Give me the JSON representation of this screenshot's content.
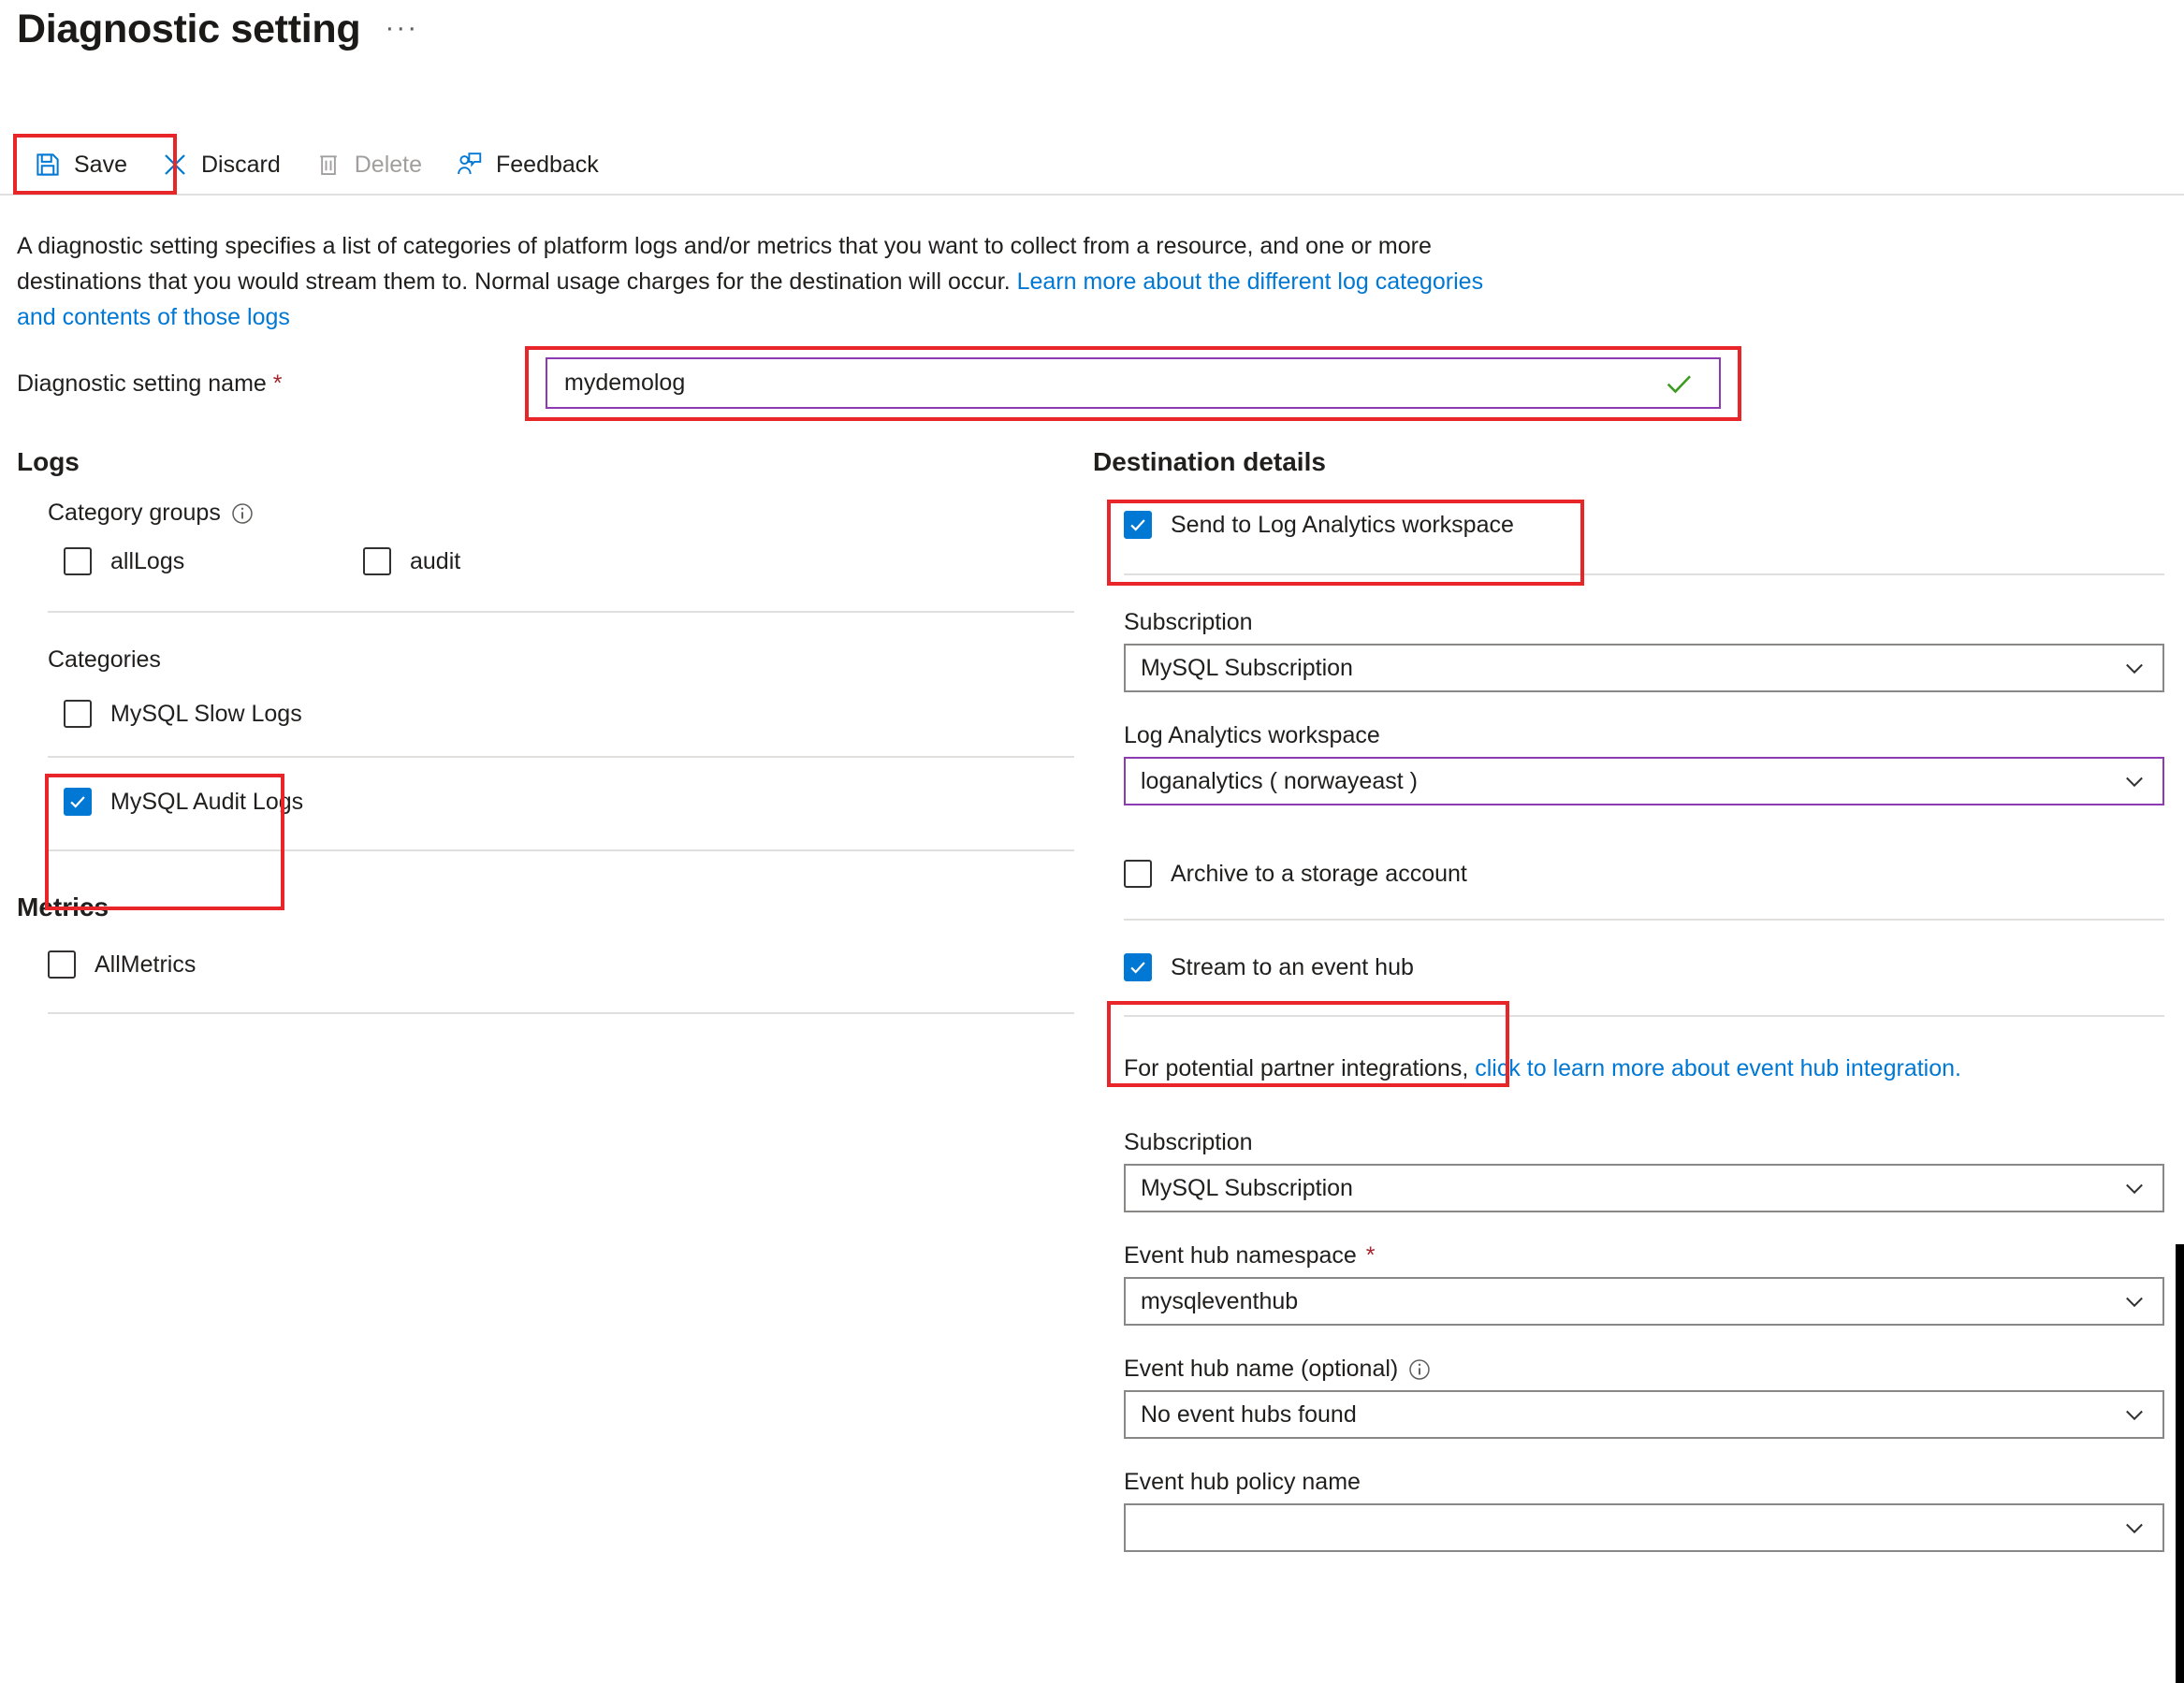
{
  "header": {
    "title": "Diagnostic setting",
    "more_label": "···"
  },
  "toolbar": {
    "save_label": "Save",
    "discard_label": "Discard",
    "delete_label": "Delete",
    "feedback_label": "Feedback"
  },
  "description": {
    "part1": "A diagnostic setting specifies a list of categories of platform logs and/or metrics that you want to collect from a resource, and one or more destinations that you would stream them to. Normal usage charges for the destination will occur. ",
    "link": "Learn more about the different log categories and contents of those logs"
  },
  "name_field": {
    "label": "Diagnostic setting name",
    "required_marker": "*",
    "value": "mydemolog",
    "placeholder": "",
    "valid_icon": "checkmark-icon"
  },
  "logs": {
    "section_title": "Logs",
    "category_groups_label": "Category groups",
    "category_groups": [
      {
        "label": "allLogs",
        "checked": false
      },
      {
        "label": "audit",
        "checked": false
      }
    ],
    "categories_label": "Categories",
    "categories": [
      {
        "label": "MySQL Slow Logs",
        "checked": false
      },
      {
        "label": "MySQL Audit Logs",
        "checked": true
      }
    ]
  },
  "metrics": {
    "section_title": "Metrics",
    "items": [
      {
        "label": "AllMetrics",
        "checked": false
      }
    ]
  },
  "destination": {
    "section_title": "Destination details",
    "log_analytics": {
      "checkbox_label": "Send to Log Analytics workspace",
      "checked": true,
      "subscription_label": "Subscription",
      "subscription_value": "MySQL  Subscription",
      "workspace_label": "Log Analytics workspace",
      "workspace_value": "loganalytics ( norwayeast )"
    },
    "storage": {
      "checkbox_label": "Archive to a storage account",
      "checked": false
    },
    "event_hub": {
      "checkbox_label": "Stream to an event hub",
      "checked": true,
      "partner_note_text": "For potential partner integrations, ",
      "partner_note_link": "click to learn more about event hub integration.",
      "subscription_label": "Subscription",
      "subscription_value": "MySQL  Subscription",
      "namespace_label": "Event hub namespace",
      "namespace_required": "*",
      "namespace_value": "mysqleventhub",
      "name_label": "Event hub name (optional)",
      "name_value": "No event hubs found",
      "policy_label": "Event hub policy name",
      "policy_value": ""
    }
  },
  "colors": {
    "accent": "#0078d4",
    "highlight": "#e8262a",
    "focus_border": "#8e3ab3",
    "valid_green": "#3c9b1e",
    "required_red": "#a4262c"
  }
}
